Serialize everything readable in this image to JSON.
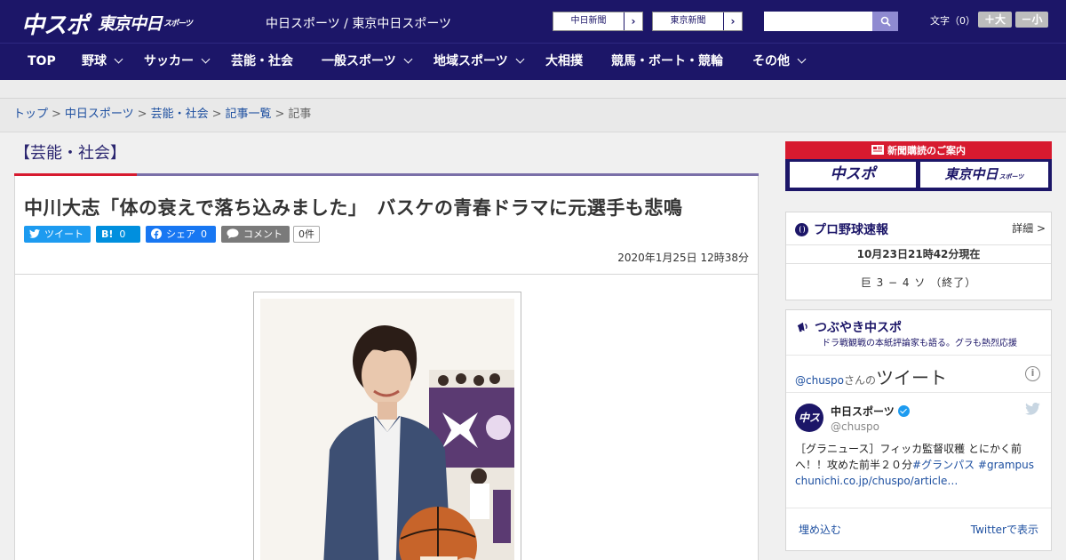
{
  "header": {
    "logo_chuspo": "中スポ",
    "logo_tokyo": "東京中日",
    "logo_tokyo_small": "スポーツ",
    "site_name": "中日スポーツ / 東京中日スポーツ",
    "ext_links": [
      {
        "label": "中日新聞"
      },
      {
        "label": "東京新聞"
      }
    ],
    "search_placeholder": "",
    "font_size_label": "文字（0）",
    "font_plus": "＋大",
    "font_minus": "－小"
  },
  "nav": {
    "items": [
      {
        "label": "TOP",
        "dropdown": false
      },
      {
        "label": "野球",
        "dropdown": true
      },
      {
        "label": "サッカー",
        "dropdown": true
      },
      {
        "label": "芸能・社会",
        "dropdown": false
      },
      {
        "label": "一般スポーツ",
        "dropdown": true
      },
      {
        "label": "地域スポーツ",
        "dropdown": true
      },
      {
        "label": "大相撲",
        "dropdown": false
      },
      {
        "label": "競馬・ボート・競輪",
        "dropdown": false
      },
      {
        "label": "その他",
        "dropdown": true
      }
    ]
  },
  "breadcrumb": {
    "items": [
      "トップ",
      "中日スポーツ",
      "芸能・社会",
      "記事一覧"
    ],
    "current": "記事",
    "separator": ">"
  },
  "article": {
    "category": "【芸能・社会】",
    "title": "中川大志「体の衰えで落ち込みました」　バスケの青春ドラマに元選手も悲鳴",
    "share": {
      "tweet": "ツイート",
      "hatena_label": "B!",
      "hatena_count": "0",
      "facebook": "シェア",
      "facebook_count": "0",
      "comment": "コメント",
      "comment_count": "0件"
    },
    "date": "2020年1月25日 12時38分"
  },
  "sidebar": {
    "subscription": {
      "title": "新聞購読のご案内",
      "logo_chuspo": "中スポ",
      "logo_tokyo": "東京中日",
      "logo_tokyo_small": "スポーツ"
    },
    "baseball": {
      "title": "プロ野球速報",
      "more": "詳細 >",
      "date": "10月23日21時42分現在",
      "score": "巨 3 − 4 ソ （終了）"
    },
    "tsubuyaki": {
      "title": "つぶやき中スポ",
      "subtitle": "ドラ戦観戦の本紙評論家も語る。グラも熱烈応援",
      "timeline_user": "@chuspo",
      "timeline_suffix": "さんの",
      "timeline_big": "ツイート",
      "info": "i",
      "tweet_name": "中日スポーツ",
      "tweet_handle": "@chuspo",
      "avatar_text": "中スポ",
      "tweet_text_1": "［グラニュース］フィッカ監督収穫 とにかく前へ！！攻めた前半２０分",
      "tweet_tag_1": "#グランパス",
      "tweet_tag_2": "#grampus",
      "tweet_link": "chunichi.co.jp/chuspo/article…",
      "embed": "埋め込む",
      "view_on_twitter": "Twitterで表示"
    }
  },
  "colors": {
    "brand_navy": "#1c1668",
    "brand_red": "#d71a2f",
    "link_blue": "#1d4fa0",
    "twitter_blue": "#1d9bf0",
    "facebook_blue": "#1877f2",
    "hatena_blue": "#008fde"
  }
}
